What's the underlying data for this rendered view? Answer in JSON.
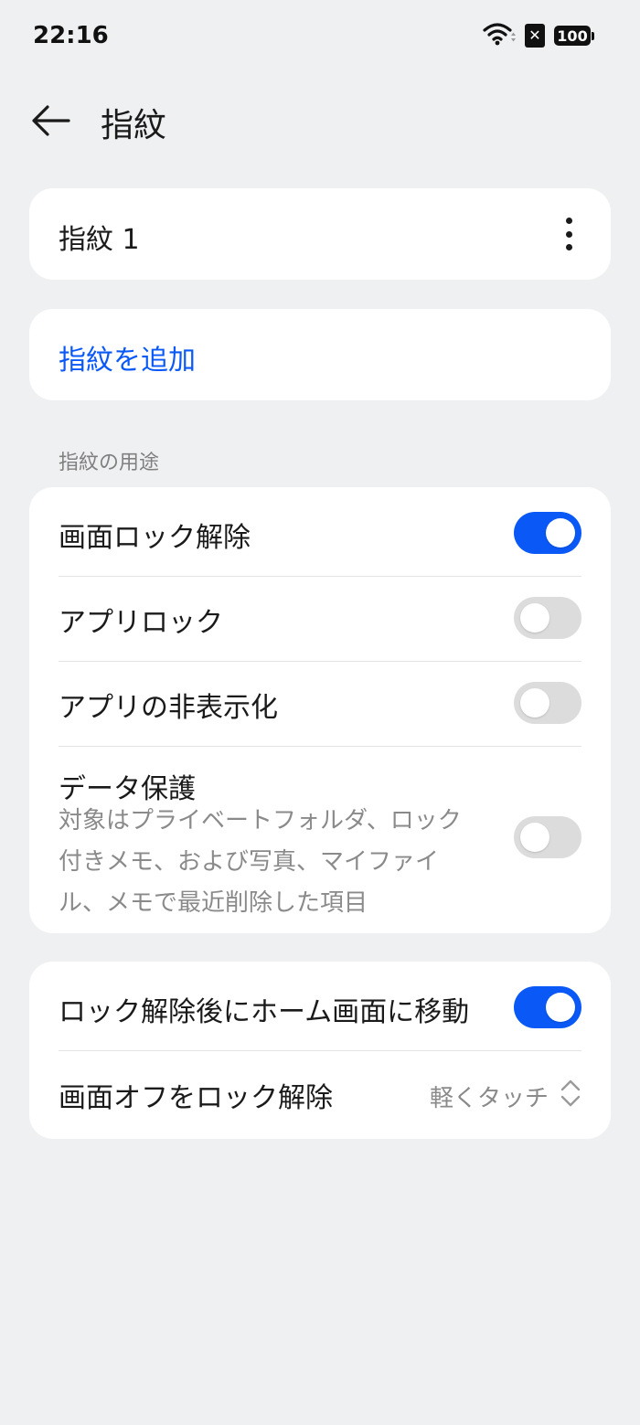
{
  "status_bar": {
    "time": "22:16",
    "battery": "100",
    "icons": [
      "wifi-icon",
      "sim-disabled-icon",
      "battery-icon"
    ]
  },
  "header": {
    "title": "指紋",
    "back_icon": "arrow-left-icon"
  },
  "fingerprints": [
    {
      "label": "指紋 1",
      "icon": "more-vertical-icon"
    }
  ],
  "add_fingerprint_label": "指紋を追加",
  "usage_section": {
    "header": "指紋の用途",
    "items": [
      {
        "label": "画面ロック解除",
        "on": true
      },
      {
        "label": "アプリロック",
        "on": false
      },
      {
        "label": "アプリの非表示化",
        "on": false
      },
      {
        "label": "データ保護",
        "sub_lines": [
          "対象はプライベートフォルダ、ロック",
          "付きメモ、および写真、マイファイ",
          "ル、メモで最近削除した項目"
        ],
        "on": false
      }
    ]
  },
  "other_section": {
    "items": [
      {
        "label": "ロック解除後にホーム画面に移動",
        "on": true
      },
      {
        "label": "画面オフをロック解除",
        "value": "軽くタッチ",
        "icon": "chevron-up-down-icon"
      }
    ]
  },
  "colors": {
    "background": "#eff0f2",
    "card": "#ffffff",
    "accent": "#0a59f7",
    "toggle_off": "#dcdcdc",
    "secondary_text": "#8a8a8a"
  }
}
